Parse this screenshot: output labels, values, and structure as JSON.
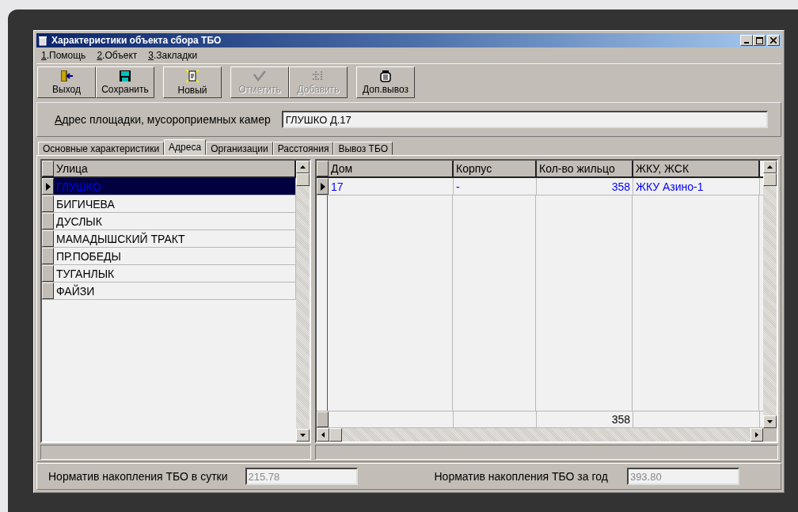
{
  "window": {
    "title": "Характеристики объекта сбора ТБО"
  },
  "menu": [
    {
      "label": "1.Помощь"
    },
    {
      "label": "2.Объект"
    },
    {
      "label": "3.Закладки"
    }
  ],
  "toolbar": [
    {
      "label": "Выход",
      "kind": "exit",
      "disabled": false
    },
    {
      "label": "Сохранить",
      "kind": "save",
      "disabled": false
    },
    {
      "label": "Новый",
      "kind": "new",
      "disabled": false
    },
    {
      "label": "Отметить",
      "kind": "check",
      "disabled": true
    },
    {
      "label": "Добавить",
      "kind": "add",
      "disabled": true
    },
    {
      "label": "Доп.вывоз",
      "kind": "bin",
      "disabled": false
    }
  ],
  "address": {
    "label": "Адрес площадки, мусороприемных камер",
    "value": "ГЛУШКО Д.17"
  },
  "tabs": [
    {
      "label": "Основные характеристики",
      "selected": false
    },
    {
      "label": "Адреса",
      "selected": true
    },
    {
      "label": "Организации",
      "selected": false
    },
    {
      "label": "Расстояния",
      "selected": false
    },
    {
      "label": "Вывоз ТБО",
      "selected": false
    }
  ],
  "streets": {
    "column": "Улица",
    "rows": [
      {
        "name": "ГЛУШКО",
        "selected": true
      },
      {
        "name": "БИГИЧЕВА",
        "selected": false
      },
      {
        "name": "ДУСЛЫК",
        "selected": false
      },
      {
        "name": "МАМАДЫШСКИЙ ТРАКТ",
        "selected": false
      },
      {
        "name": "ПР.ПОБЕДЫ",
        "selected": false
      },
      {
        "name": "ТУГАНЛЫК",
        "selected": false
      },
      {
        "name": "ФАЙЗИ",
        "selected": false
      }
    ]
  },
  "houses": {
    "columns": [
      "Дом",
      "Корпус",
      "Кол-во жильцо",
      "ЖКУ, ЖСК"
    ],
    "rows": [
      {
        "cells": [
          "17",
          "-",
          "358",
          "ЖКУ Азино-1"
        ],
        "selected": true
      }
    ],
    "total_residents": "358"
  },
  "norms": [
    {
      "label": "Норматив накопления ТБО в сутки",
      "value": "215.78",
      "disabled": true
    },
    {
      "label": "Норматив накопления ТБО за год",
      "value": "393.80",
      "disabled": true
    }
  ]
}
